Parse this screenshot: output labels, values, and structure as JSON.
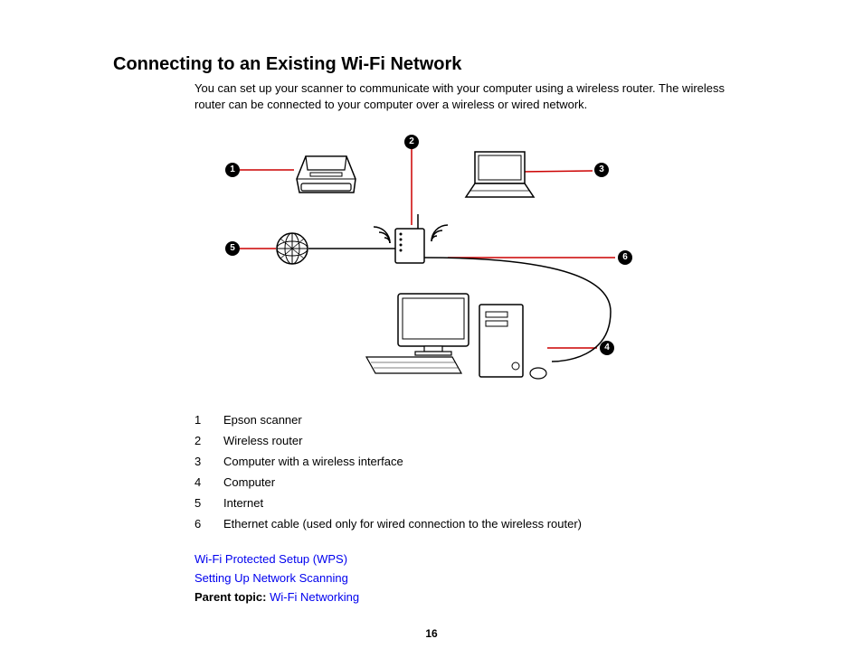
{
  "title": "Connecting to an Existing Wi-Fi Network",
  "intro": "You can set up your scanner to communicate with your computer using a wireless router. The wireless router can be connected to your computer over a wireless or wired network.",
  "callouts": {
    "c1": "1",
    "c2": "2",
    "c3": "3",
    "c4": "4",
    "c5": "5",
    "c6": "6"
  },
  "legend": [
    {
      "num": "1",
      "label": "Epson scanner"
    },
    {
      "num": "2",
      "label": "Wireless router"
    },
    {
      "num": "3",
      "label": "Computer with a wireless interface"
    },
    {
      "num": "4",
      "label": "Computer"
    },
    {
      "num": "5",
      "label": "Internet"
    },
    {
      "num": "6",
      "label": "Ethernet cable (used only for wired connection to the wireless router)"
    }
  ],
  "links": {
    "wps": "Wi-Fi Protected Setup (WPS)",
    "scanning": "Setting Up Network Scanning",
    "parent_label": "Parent topic:",
    "parent_link": "Wi-Fi Networking"
  },
  "page_number": "16"
}
